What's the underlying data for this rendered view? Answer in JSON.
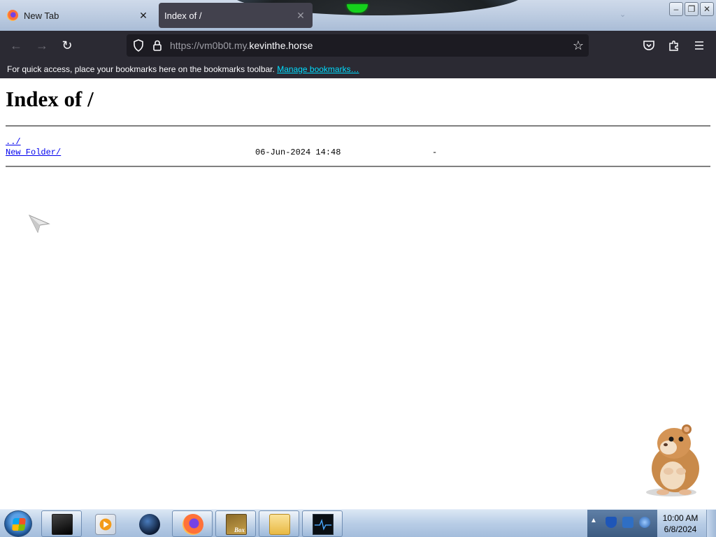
{
  "tabs": [
    {
      "title": "New Tab",
      "close_glyph": "✕",
      "active": false
    },
    {
      "title": "Index of /",
      "close_glyph": "✕",
      "active": true
    }
  ],
  "navbar": {
    "back_glyph": "←",
    "forward_glyph": "→",
    "reload_glyph": "↻",
    "url_prefix": "https://vm0b0t.my.",
    "url_host": "kevinthe.horse",
    "bookmark_star_glyph": "☆"
  },
  "bookmarks_bar": {
    "message": "For quick access, place your bookmarks here on the bookmarks toolbar.",
    "manage_link": "Manage bookmarks…"
  },
  "page": {
    "heading": "Index of /",
    "entries": [
      {
        "name": "../",
        "date": "",
        "size": ""
      },
      {
        "name": "New Folder/",
        "date": "06-Jun-2024 14:48",
        "size": "-"
      }
    ]
  },
  "taskbar": {
    "clock_time": "10:00 AM",
    "clock_date": "6/8/2024",
    "tray_arrow": "▲",
    "box_label": "Box"
  },
  "colors": {
    "browser_chrome": "#2b2a33",
    "url_field": "#1c1b22",
    "link_blue": "#0000ee",
    "bookmark_link": "#00ddff"
  }
}
